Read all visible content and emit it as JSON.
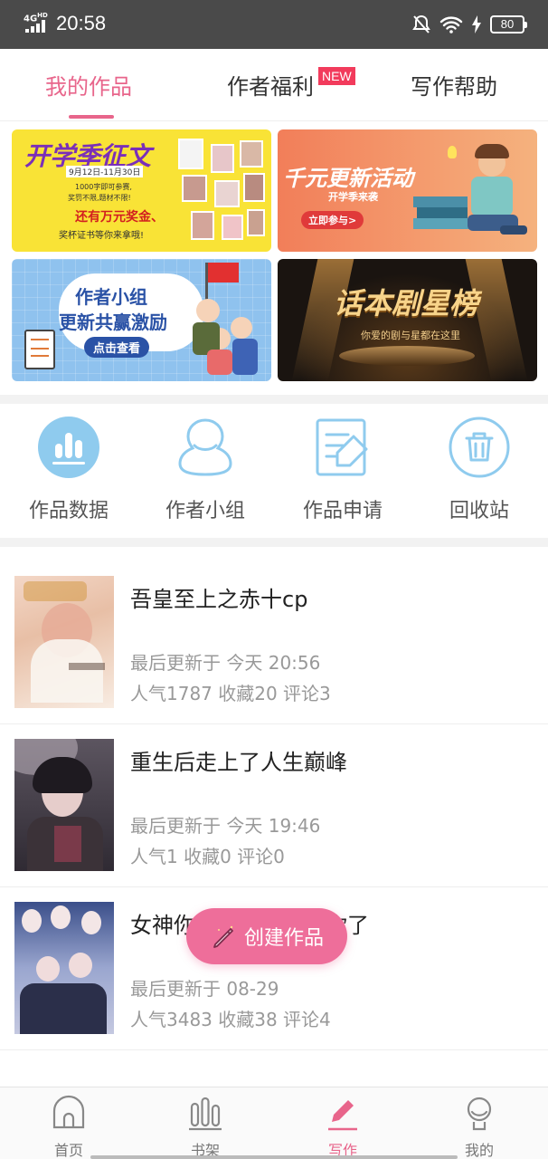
{
  "status_bar": {
    "network": "4G",
    "network_sup": "HD",
    "time": "20:58",
    "battery": "80"
  },
  "tabs": [
    {
      "label": "我的作品",
      "active": true
    },
    {
      "label": "作者福利",
      "badge": "NEW"
    },
    {
      "label": "写作帮助"
    }
  ],
  "banners": [
    {
      "title": "开学季征文",
      "line1": "9月12日-11月30日",
      "line2": "1000字即可参赛,",
      "line3": "奖罚不限,题材不限!",
      "line4": "还有万元奖金、",
      "line5": "奖杯证书等你来拿哦!"
    },
    {
      "title": "千元更新活动",
      "subtitle": "开学季来袭",
      "button": "立即参与>"
    },
    {
      "title_line1": "作者小组",
      "title_line2": "更新共赢激励",
      "button": "点击查看"
    },
    {
      "title": "话本剧星榜",
      "subtitle": "你爱的剧与星都在这里"
    }
  ],
  "quick_actions": [
    {
      "label": "作品数据",
      "icon": "bar-chart-icon"
    },
    {
      "label": "作者小组",
      "icon": "group-icon"
    },
    {
      "label": "作品申请",
      "icon": "edit-document-icon"
    },
    {
      "label": "回收站",
      "icon": "trash-icon"
    }
  ],
  "works": [
    {
      "title": "吾皇至上之赤十cp",
      "updated": "最后更新于 今天 20:56",
      "stats": "人气1787 收藏20 评论3"
    },
    {
      "title": "重生后走上了人生巅峰",
      "updated": "最后更新于 今天 19:46",
      "stats": "人气1 收藏0 评论0"
    },
    {
      "title": "女神你别跑，我追到你了",
      "updated": "最后更新于 08-29",
      "stats": "人气3483 收藏38 评论4"
    }
  ],
  "fab": {
    "label": "创建作品"
  },
  "bottom_nav": [
    {
      "label": "首页",
      "icon": "home-icon"
    },
    {
      "label": "书架",
      "icon": "bookshelf-icon"
    },
    {
      "label": "写作",
      "icon": "pen-icon",
      "active": true
    },
    {
      "label": "我的",
      "icon": "profile-icon"
    }
  ],
  "colors": {
    "accent": "#e8658b",
    "fab": "#ee6e9a",
    "icon_blue": "#8fcbee"
  }
}
